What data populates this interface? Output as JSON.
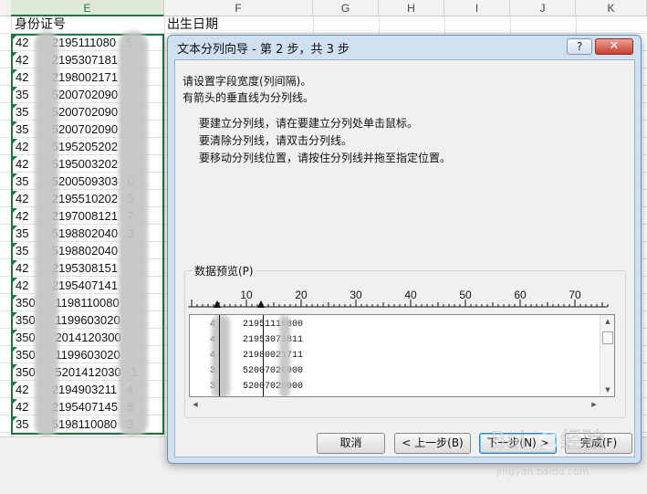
{
  "sheet": {
    "columns": [
      "E",
      "F",
      "G",
      "H",
      "I",
      "J",
      "K"
    ],
    "headers": {
      "e": "身份证号",
      "f": "出生日期"
    },
    "rows": [
      "42       2195111080   5",
      "42       2195307181",
      "42       2198002171",
      "35       5200702090",
      "35       5200702090",
      "35       5200702090",
      "42       5195205202",
      "42       5195003202",
      "35       5200509303   0",
      "42       2195510202   5",
      "42       2197008121   7",
      "35       5198802040   3",
      "35       5198802040",
      "42       2195308151",
      "42       2195407141",
      "350      1198110080",
      "350      1199603020",
      "350      2014120300",
      "350      1199603020",
      "350      5201412030   1",
      "42       2194903211   4",
      "42       2195407145   5",
      "35       5198110080   3"
    ]
  },
  "dialog": {
    "title": "文本分列向导 - 第 2 步，共 3 步",
    "help": "?",
    "close": "✕",
    "intro": [
      "请设置字段宽度(列间隔)。",
      "有箭头的垂直线为分列线。"
    ],
    "instructions": [
      "要建立分列线，请在要建立分列处单击鼠标。",
      "要清除分列线，请双击分列线。",
      "要移动分列线位置，请按住分列线并拖至指定位置。"
    ],
    "preview_label": "数据预览(P)",
    "ruler": [
      "10",
      "20",
      "30",
      "40",
      "50",
      "60",
      "70"
    ],
    "preview_rows": [
      "4     21951110800",
      "4     21953071811",
      "4     21980021711",
      "3     52007020900",
      "3     52007020900"
    ],
    "buttons": {
      "cancel": "取消",
      "back": "< 上一步(B)",
      "next": "下一步(N) >",
      "finish": "完成(F)"
    }
  },
  "watermark": {
    "site": "jingyan.baidu.com"
  }
}
